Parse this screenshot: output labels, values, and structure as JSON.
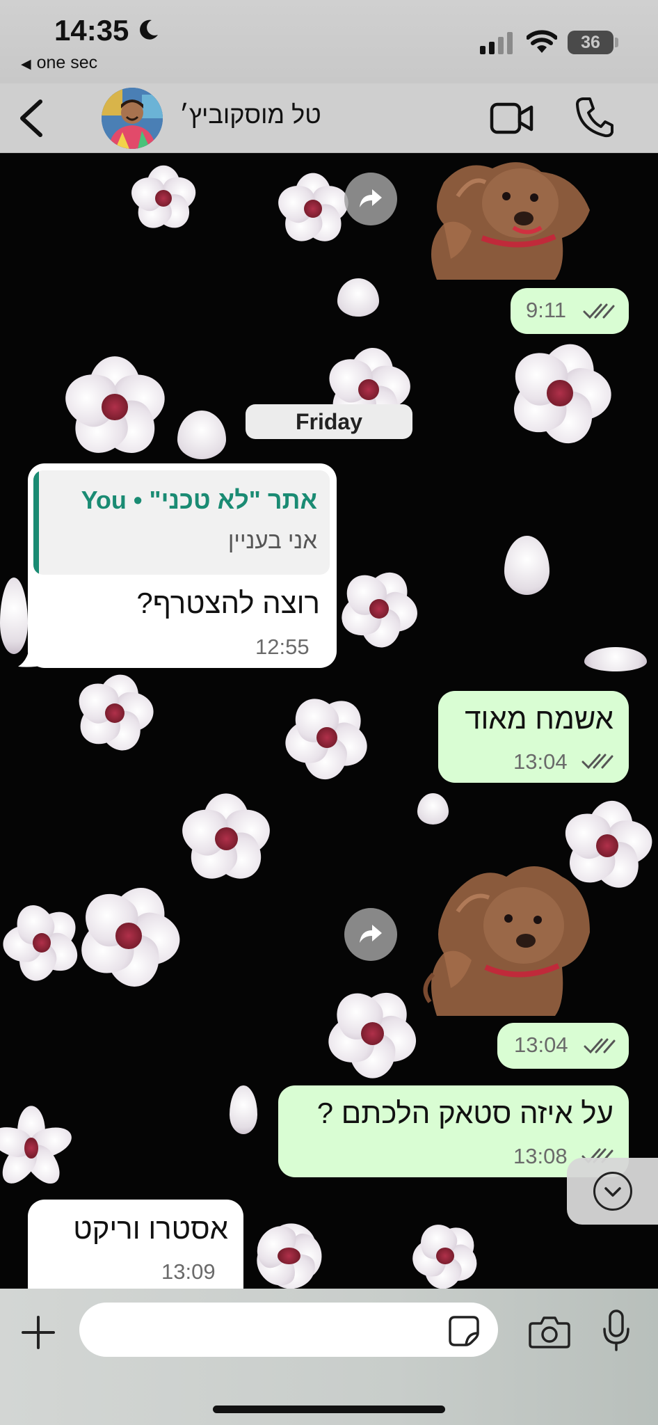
{
  "status_bar": {
    "time": "14:35",
    "back_app": "one sec",
    "battery": "36"
  },
  "header": {
    "contact_name": "טל מוסקוביץ׳"
  },
  "day_separator": "Friday",
  "messages": [
    {
      "type": "sticker",
      "direction": "out",
      "time": "9:11",
      "status": "read"
    },
    {
      "type": "text",
      "direction": "in",
      "quote": {
        "author": "You • \"אתר \"לא טכני",
        "text": "אני בעניין"
      },
      "text": "רוצה להצטרף?",
      "time": "12:55"
    },
    {
      "type": "text",
      "direction": "out",
      "text": "אשמח מאוד",
      "time": "13:04",
      "status": "read"
    },
    {
      "type": "sticker",
      "direction": "out",
      "time": "13:04",
      "status": "read"
    },
    {
      "type": "text",
      "direction": "out",
      "text": "על איזה סטאק הלכתם ?",
      "time": "13:08",
      "status": "read"
    },
    {
      "type": "text",
      "direction": "in",
      "text": "אסטרו וריקט",
      "time": "13:09"
    }
  ],
  "input": {
    "placeholder": ""
  },
  "colors": {
    "outgoing_bubble": "#d9fdd3",
    "incoming_bubble": "#ffffff",
    "quote_accent": "#1a8b73",
    "read_ticks": "#555555"
  },
  "icons": {
    "back": "chevron-left-icon",
    "video": "video-camera-icon",
    "call": "phone-icon",
    "forward": "forward-arrow-icon",
    "plus": "plus-icon",
    "sticker": "sticker-icon",
    "camera": "camera-icon",
    "mic": "microphone-icon",
    "scroll_down": "chevron-down-circle-icon"
  }
}
